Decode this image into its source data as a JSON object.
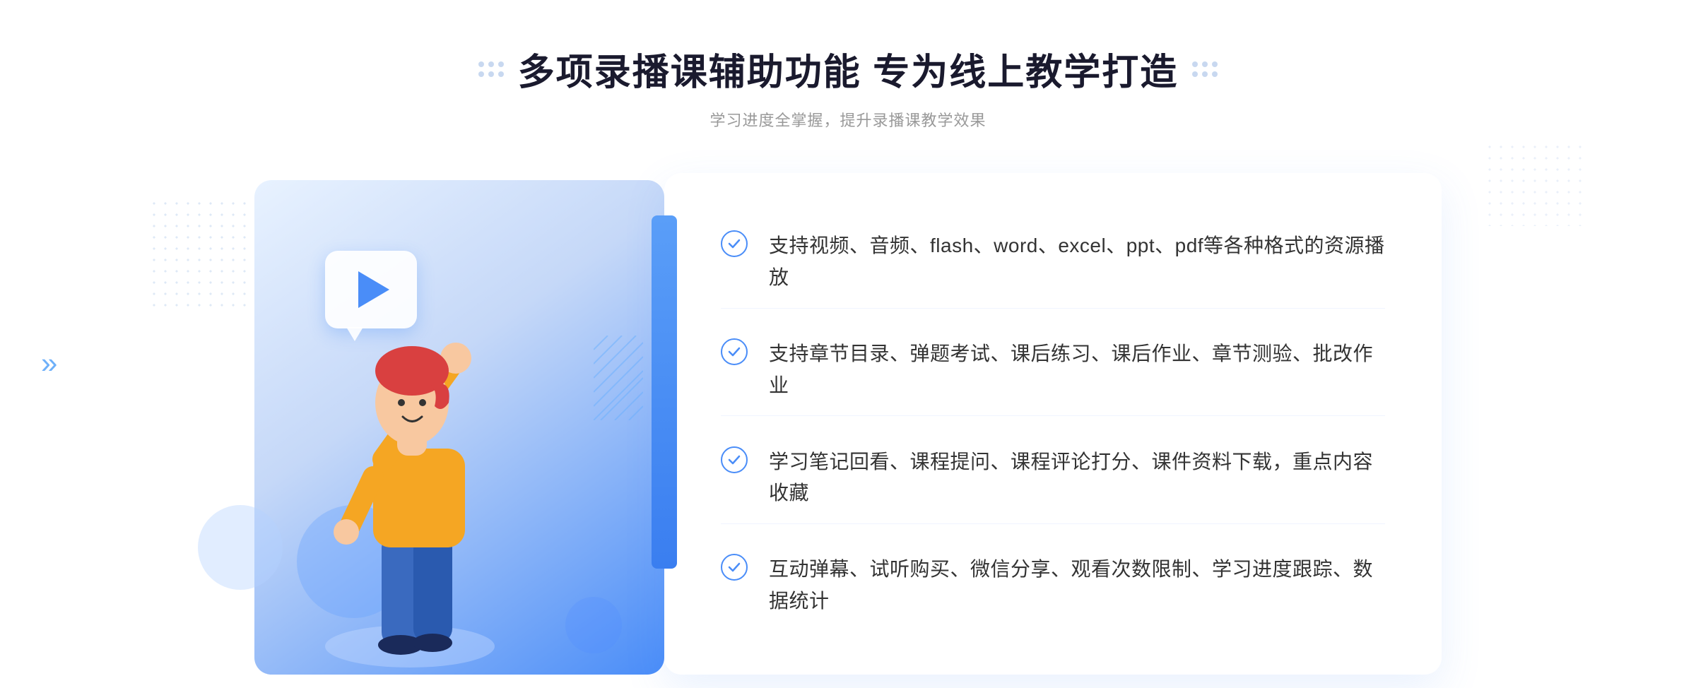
{
  "header": {
    "title": "多项录播课辅助功能 专为线上教学打造",
    "subtitle": "学习进度全掌握，提升录播课教学效果"
  },
  "features": [
    {
      "id": "feature-1",
      "text": "支持视频、音频、flash、word、excel、ppt、pdf等各种格式的资源播放"
    },
    {
      "id": "feature-2",
      "text": "支持章节目录、弹题考试、课后练习、课后作业、章节测验、批改作业"
    },
    {
      "id": "feature-3",
      "text": "学习笔记回看、课程提问、课程评论打分、课件资料下载，重点内容收藏"
    },
    {
      "id": "feature-4",
      "text": "互动弹幕、试听购买、微信分享、观看次数限制、学习进度跟踪、数据统计"
    }
  ],
  "decorations": {
    "chevron_left": "»",
    "play_icon": "▶"
  },
  "colors": {
    "primary_blue": "#4a8df8",
    "light_blue": "#e8f2ff",
    "text_dark": "#1a1a2e",
    "text_gray": "#999999",
    "text_body": "#333333"
  }
}
